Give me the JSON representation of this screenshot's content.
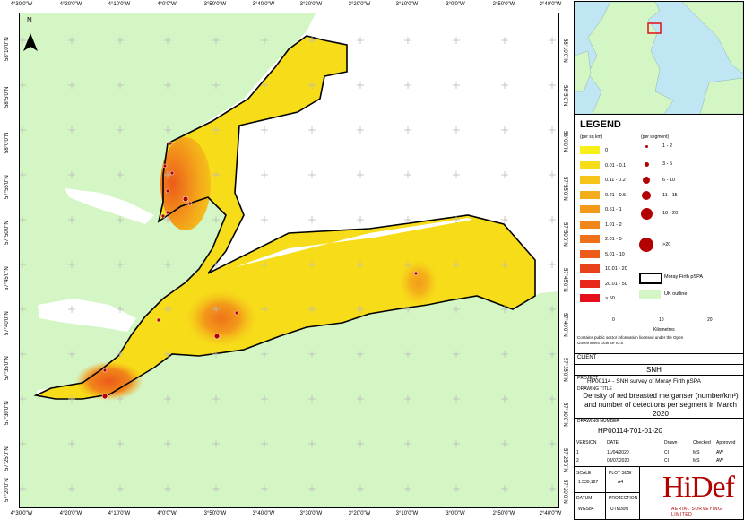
{
  "map": {
    "north_label": "N",
    "top_ticks": [
      "4°30'0\"W",
      "4°20'0\"W",
      "4°10'0\"W",
      "4°0'0\"W",
      "3°50'0\"W",
      "3°40'0\"W",
      "3°30'0\"W",
      "3°20'0\"W",
      "3°10'0\"W",
      "3°0'0\"W",
      "2°50'0\"W",
      "2°40'0\"W"
    ],
    "bottom_ticks": [
      "4°30'0\"W",
      "4°20'0\"W",
      "4°10'0\"W",
      "4°0'0\"W",
      "3°50'0\"W",
      "3°40'0\"W",
      "3°30'0\"W",
      "3°20'0\"W",
      "3°10'0\"W",
      "3°0'0\"W",
      "2°50'0\"W",
      "2°40'0\"W"
    ],
    "lat_ticks": [
      "58°10'0\"N",
      "58°5'0\"N",
      "58°0'0\"N",
      "57°55'0\"N",
      "57°50'0\"N",
      "57°45'0\"N",
      "57°40'0\"N",
      "57°35'0\"N",
      "57°30'0\"N",
      "57°25'0\"N",
      "57°20'0\"N"
    ],
    "colors": {
      "land": "#d4f5c4",
      "sea": "#ffffff",
      "outline": "#000000"
    }
  },
  "legend": {
    "title": "LEGEND",
    "density_header": "(per sq km)",
    "segment_header": "(per segment)",
    "density_classes": [
      {
        "label": "0",
        "color": "#f7f01a"
      },
      {
        "label": "0.01 - 0.1",
        "color": "#f7dc1a"
      },
      {
        "label": "0.11 - 0.2",
        "color": "#f5c51a"
      },
      {
        "label": "0.21 - 0.5",
        "color": "#f4ad1a"
      },
      {
        "label": "0.51 - 1",
        "color": "#f39a1a"
      },
      {
        "label": "1.01 - 2",
        "color": "#f1861a"
      },
      {
        "label": "2.01 - 5",
        "color": "#ef721a"
      },
      {
        "label": "5.01 - 10",
        "color": "#ec5b1a"
      },
      {
        "label": "10.01 - 20",
        "color": "#e9411a"
      },
      {
        "label": "20.01 - 50",
        "color": "#e7271a"
      },
      {
        "label": "> 50",
        "color": "#e40f1a"
      }
    ],
    "segment_classes": [
      "1 - 2",
      "3 - 5",
      "6 - 10",
      "11 - 15",
      "16 - 20",
      ">20"
    ],
    "dot_color": "#b30000",
    "pspa_label": "Moray Firth pSPA",
    "uk_label": "UK outline",
    "scale_ticks": [
      "0",
      "10",
      "20"
    ],
    "scale_unit": "Kilometres",
    "licence": "Contains public sector information licensed under the Open Government Licence v3.0"
  },
  "client": {
    "label": "CLIENT",
    "value": "SNH"
  },
  "project": {
    "label": "PROJECT",
    "value": "HP00114 - SNH survey of Moray Firth pSPA"
  },
  "drawing_title": {
    "label": "DRAWING TITLE",
    "value": "Density of red breasted merganser (number/km²) and number of detections per segment in March 2020"
  },
  "drawing_number": {
    "label": "DRAWING NUMBER",
    "value": "HP00114-701-01-20"
  },
  "revisions": {
    "headers": [
      "VERSION",
      "DATE",
      "Drawn",
      "Checked",
      "Approved"
    ],
    "rows": [
      [
        "1",
        "11/04/2020",
        "CI",
        "MS",
        "AW"
      ],
      [
        "2",
        "03/07/2020",
        "CI",
        "MS",
        "AW"
      ]
    ]
  },
  "footer": {
    "scale_label": "SCALE",
    "scale_value": "1:530,187",
    "plot_label": "PLOT SIZE",
    "plot_value": "A4",
    "datum_label": "DATUM",
    "datum_value": "WGS84",
    "projection_label": "PROJECTION",
    "projection_value": "UTM30N",
    "logo_text": "HiDef",
    "logo_sub": "AERIAL SURVEYING LIMITED"
  }
}
